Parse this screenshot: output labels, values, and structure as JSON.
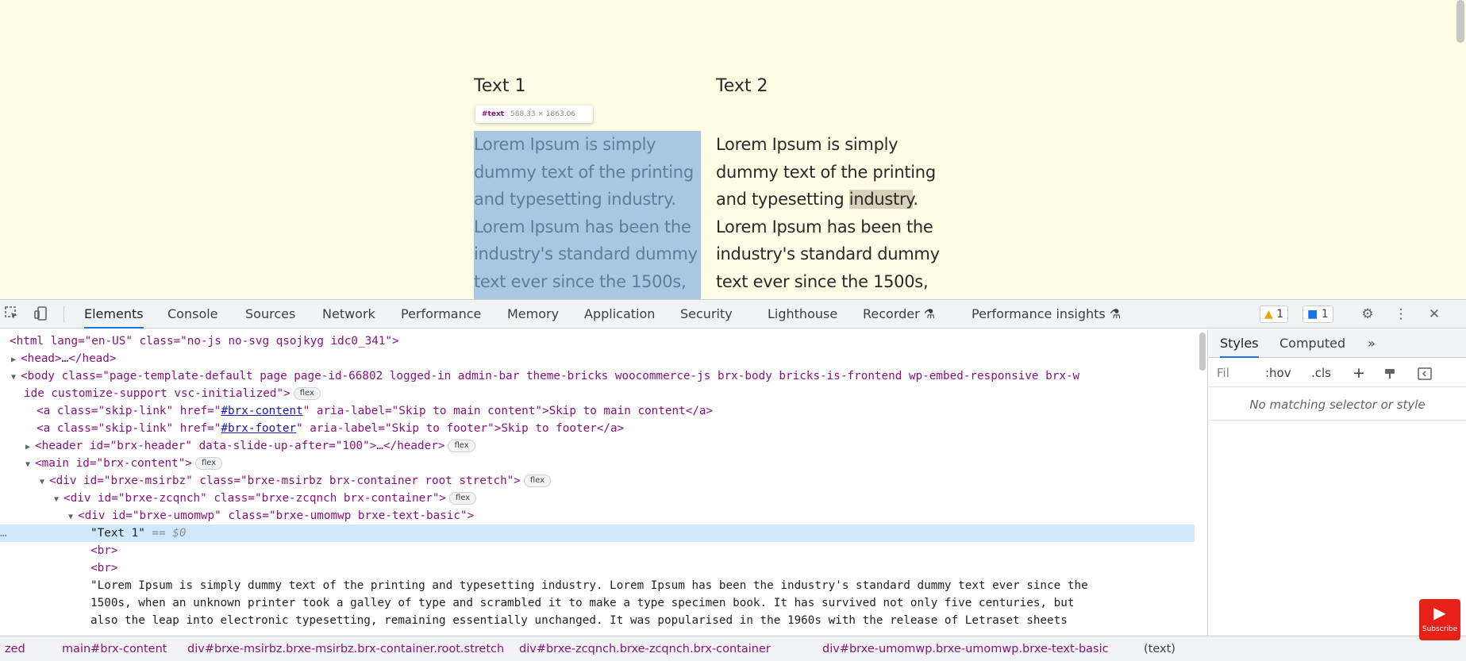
{
  "page": {
    "col1": {
      "heading": "Text 1",
      "lines": [
        "Lorem Ipsum is simply",
        "dummy text of the printing",
        "and typesetting industry.",
        "Lorem Ipsum has been the",
        "industry's standard dummy",
        "text ever since the 1500s,"
      ]
    },
    "col2": {
      "heading": "Text 2",
      "line1": "Lorem Ipsum is simply",
      "line2": "dummy text of the printing",
      "line3_pre": "and typesetting ",
      "line3_hl": "industry",
      "line3_post": ".",
      "line4": "Lorem Ipsum has been the",
      "line5": "industry's standard dummy",
      "line6": "text ever since the 1500s,"
    },
    "tooltip": {
      "tag": "#text",
      "size": "588.33 × 1863.06"
    },
    "highlight_color": "#a9c6e2",
    "background_color": "#fdfce4"
  },
  "devtools": {
    "tabs": [
      "Elements",
      "Console",
      "Sources",
      "Network",
      "Performance",
      "Memory",
      "Application",
      "Security",
      "Lighthouse",
      "Recorder",
      "Performance insights"
    ],
    "active_tab": "Elements",
    "icons": {
      "inspect": "inspect-icon",
      "device": "device-toolbar-icon",
      "recorder_flask": "flask-icon",
      "settings": "gear-icon",
      "more": "kebab-menu-icon",
      "close": "close-icon"
    },
    "warnings_count": "1",
    "messages_count": "1",
    "dom": {
      "html_open": "<html lang=\"en-US\" class=\"no-js no-svg qsojkyg idc0_341\">",
      "head": "<head>…</head>",
      "body_open_a": "<body class=\"page-template-default page page-id-66802 logged-in admin-bar theme-bricks woocommerce-js brx-body bricks-is-frontend wp-embed-responsive brx-w",
      "body_open_b": "ide customize-support vsc-initialized\">",
      "skip1_pre": "<a class=\"skip-link\" href=\"",
      "skip1_href": "#brx-content",
      "skip1_post": "\" aria-label=\"Skip to main content\">Skip to main content</a>",
      "skip2_pre": "<a class=\"skip-link\" href=\"",
      "skip2_href": "#brx-footer",
      "skip2_post": "\" aria-label=\"Skip to footer\">Skip to footer</a>",
      "header": "<header id=\"brx-header\" data-slide-up-after=\"100\">…</header>",
      "main_open": "<main id=\"brx-content\">",
      "div1": "<div id=\"brxe-msirbz\" class=\"brxe-msirbz brx-container root stretch\">",
      "div2": "<div id=\"brxe-zcqnch\" class=\"brxe-zcqnch brx-container\">",
      "div3": "<div id=\"brxe-umomwp\" class=\"brxe-umomwp brxe-text-basic\">",
      "selected_text": "\"Text 1\"",
      "selected_suffix": "== $0",
      "br1": "<br>",
      "br2": "<br>",
      "lorem_1": "\"Lorem Ipsum is simply dummy text of the printing and typesetting industry. Lorem Ipsum has been the industry's standard dummy text ever since the",
      "lorem_2": "1500s, when an unknown printer took a galley of type and scrambled it to make a type specimen book. It has survived not only five centuries, but",
      "lorem_3": "also the leap into electronic typesetting, remaining essentially unchanged. It was popularised in the 1960s with the release of Letraset sheets",
      "flex_badge": "flex",
      "selection_ellipsis": "…"
    },
    "styles": {
      "tabs": [
        "Styles",
        "Computed"
      ],
      "more": "»",
      "filter_placeholder": "Fil",
      "hov": ":hov",
      "cls": ".cls",
      "add": "+",
      "no_match": "No matching selector or style"
    },
    "breadcrumb": [
      "zed",
      "main#brx-content",
      "div#brxe-msirbz.brxe-msirbz.brx-container.root.stretch",
      "div#brxe-zcqnch.brxe-zcqnch.brx-container",
      "div#brxe-umomwp.brxe-umomwp.brxe-text-basic",
      "(text)"
    ]
  },
  "overlay": {
    "subscribe_label": "Subscribe",
    "subscribe_color": "#e62117"
  }
}
